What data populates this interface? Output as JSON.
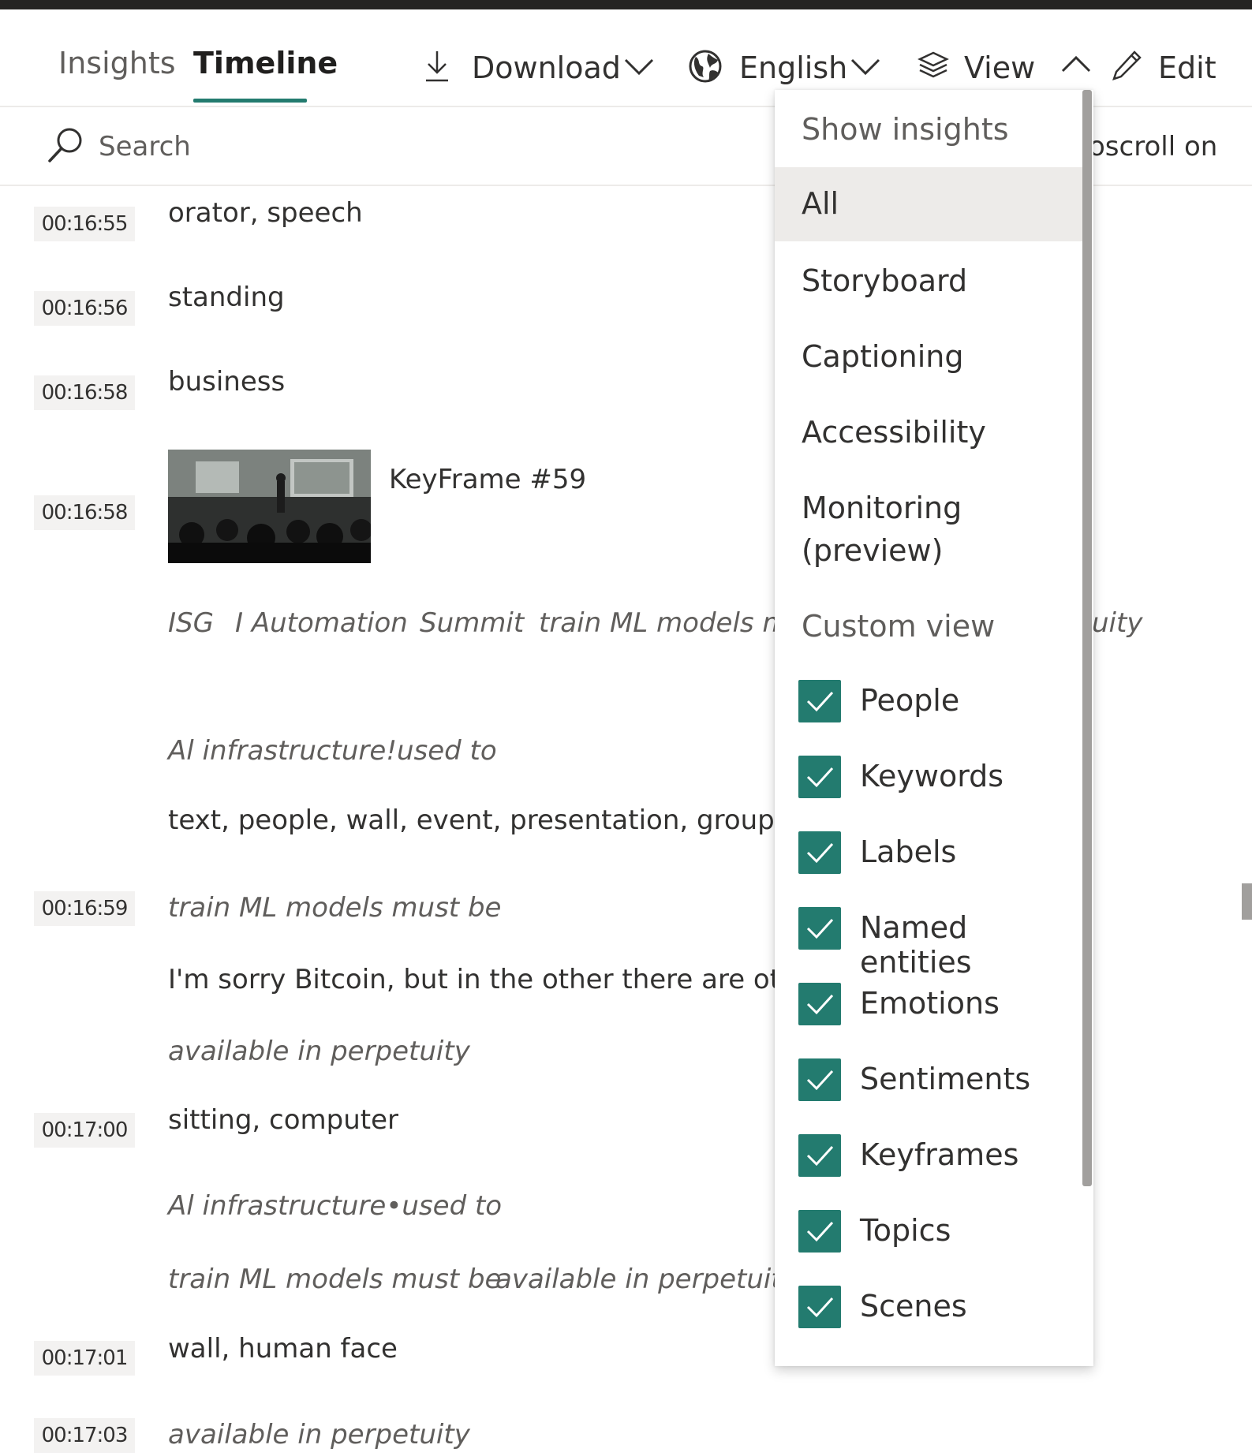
{
  "header": {
    "tabs": [
      {
        "label": "Insights",
        "active": false
      },
      {
        "label": "Timeline",
        "active": true
      }
    ],
    "download_label": "Download",
    "language_label": "English",
    "view_label": "View",
    "edit_label": "Edit",
    "accent_color": "#237b6f"
  },
  "search": {
    "placeholder": "Search",
    "autoscroll_partial": "oscroll on"
  },
  "timeline": {
    "entries": [
      {
        "time": "00:16:55",
        "text": "orator, speech"
      },
      {
        "time": "00:16:56",
        "text": "standing"
      },
      {
        "time": "00:16:58",
        "text": "business"
      },
      {
        "time": "00:16:58",
        "keyframe": "KeyFrame #59"
      },
      {
        "ocr_line": [
          "ISG",
          "I Automation",
          "Summit",
          "train ML models mu"
        ],
        "ocr_tail": "uity"
      },
      {
        "ocr": "Al infrastructure!used to"
      },
      {
        "labels": "text, people, wall, event, presentation, group, ind"
      },
      {
        "time": "00:16:59",
        "ocr": "train ML models must be"
      },
      {
        "transcript": "I'm sorry Bitcoin, but in the other there are other c"
      },
      {
        "ocr": "available in perpetuity"
      },
      {
        "time": "00:17:00",
        "text": "sitting, computer"
      },
      {
        "ocr": "Al infrastructure•used to"
      },
      {
        "ocr_line": [
          "train ML models must be",
          "available in perpetuity"
        ]
      },
      {
        "time": "00:17:01",
        "text": "wall, human face"
      },
      {
        "time": "00:17:03",
        "ocr": "available in perpetuity"
      }
    ]
  },
  "view_menu": {
    "header": "Show insights",
    "options": [
      "All",
      "Storyboard",
      "Captioning",
      "Accessibility",
      "Monitoring\n(preview)"
    ],
    "selected": "All",
    "monitoring_line1": "Monitoring",
    "monitoring_line2": "(preview)",
    "custom_header": "Custom view",
    "custom_items": [
      {
        "label": "People",
        "checked": true
      },
      {
        "label": "Keywords",
        "checked": true
      },
      {
        "label": "Labels",
        "checked": true
      },
      {
        "label": "Named entities",
        "checked": true
      },
      {
        "label": "Emotions",
        "checked": true
      },
      {
        "label": "Sentiments",
        "checked": true
      },
      {
        "label": "Keyframes",
        "checked": true
      },
      {
        "label": "Topics",
        "checked": true
      },
      {
        "label": "Scenes",
        "checked": true
      }
    ]
  }
}
